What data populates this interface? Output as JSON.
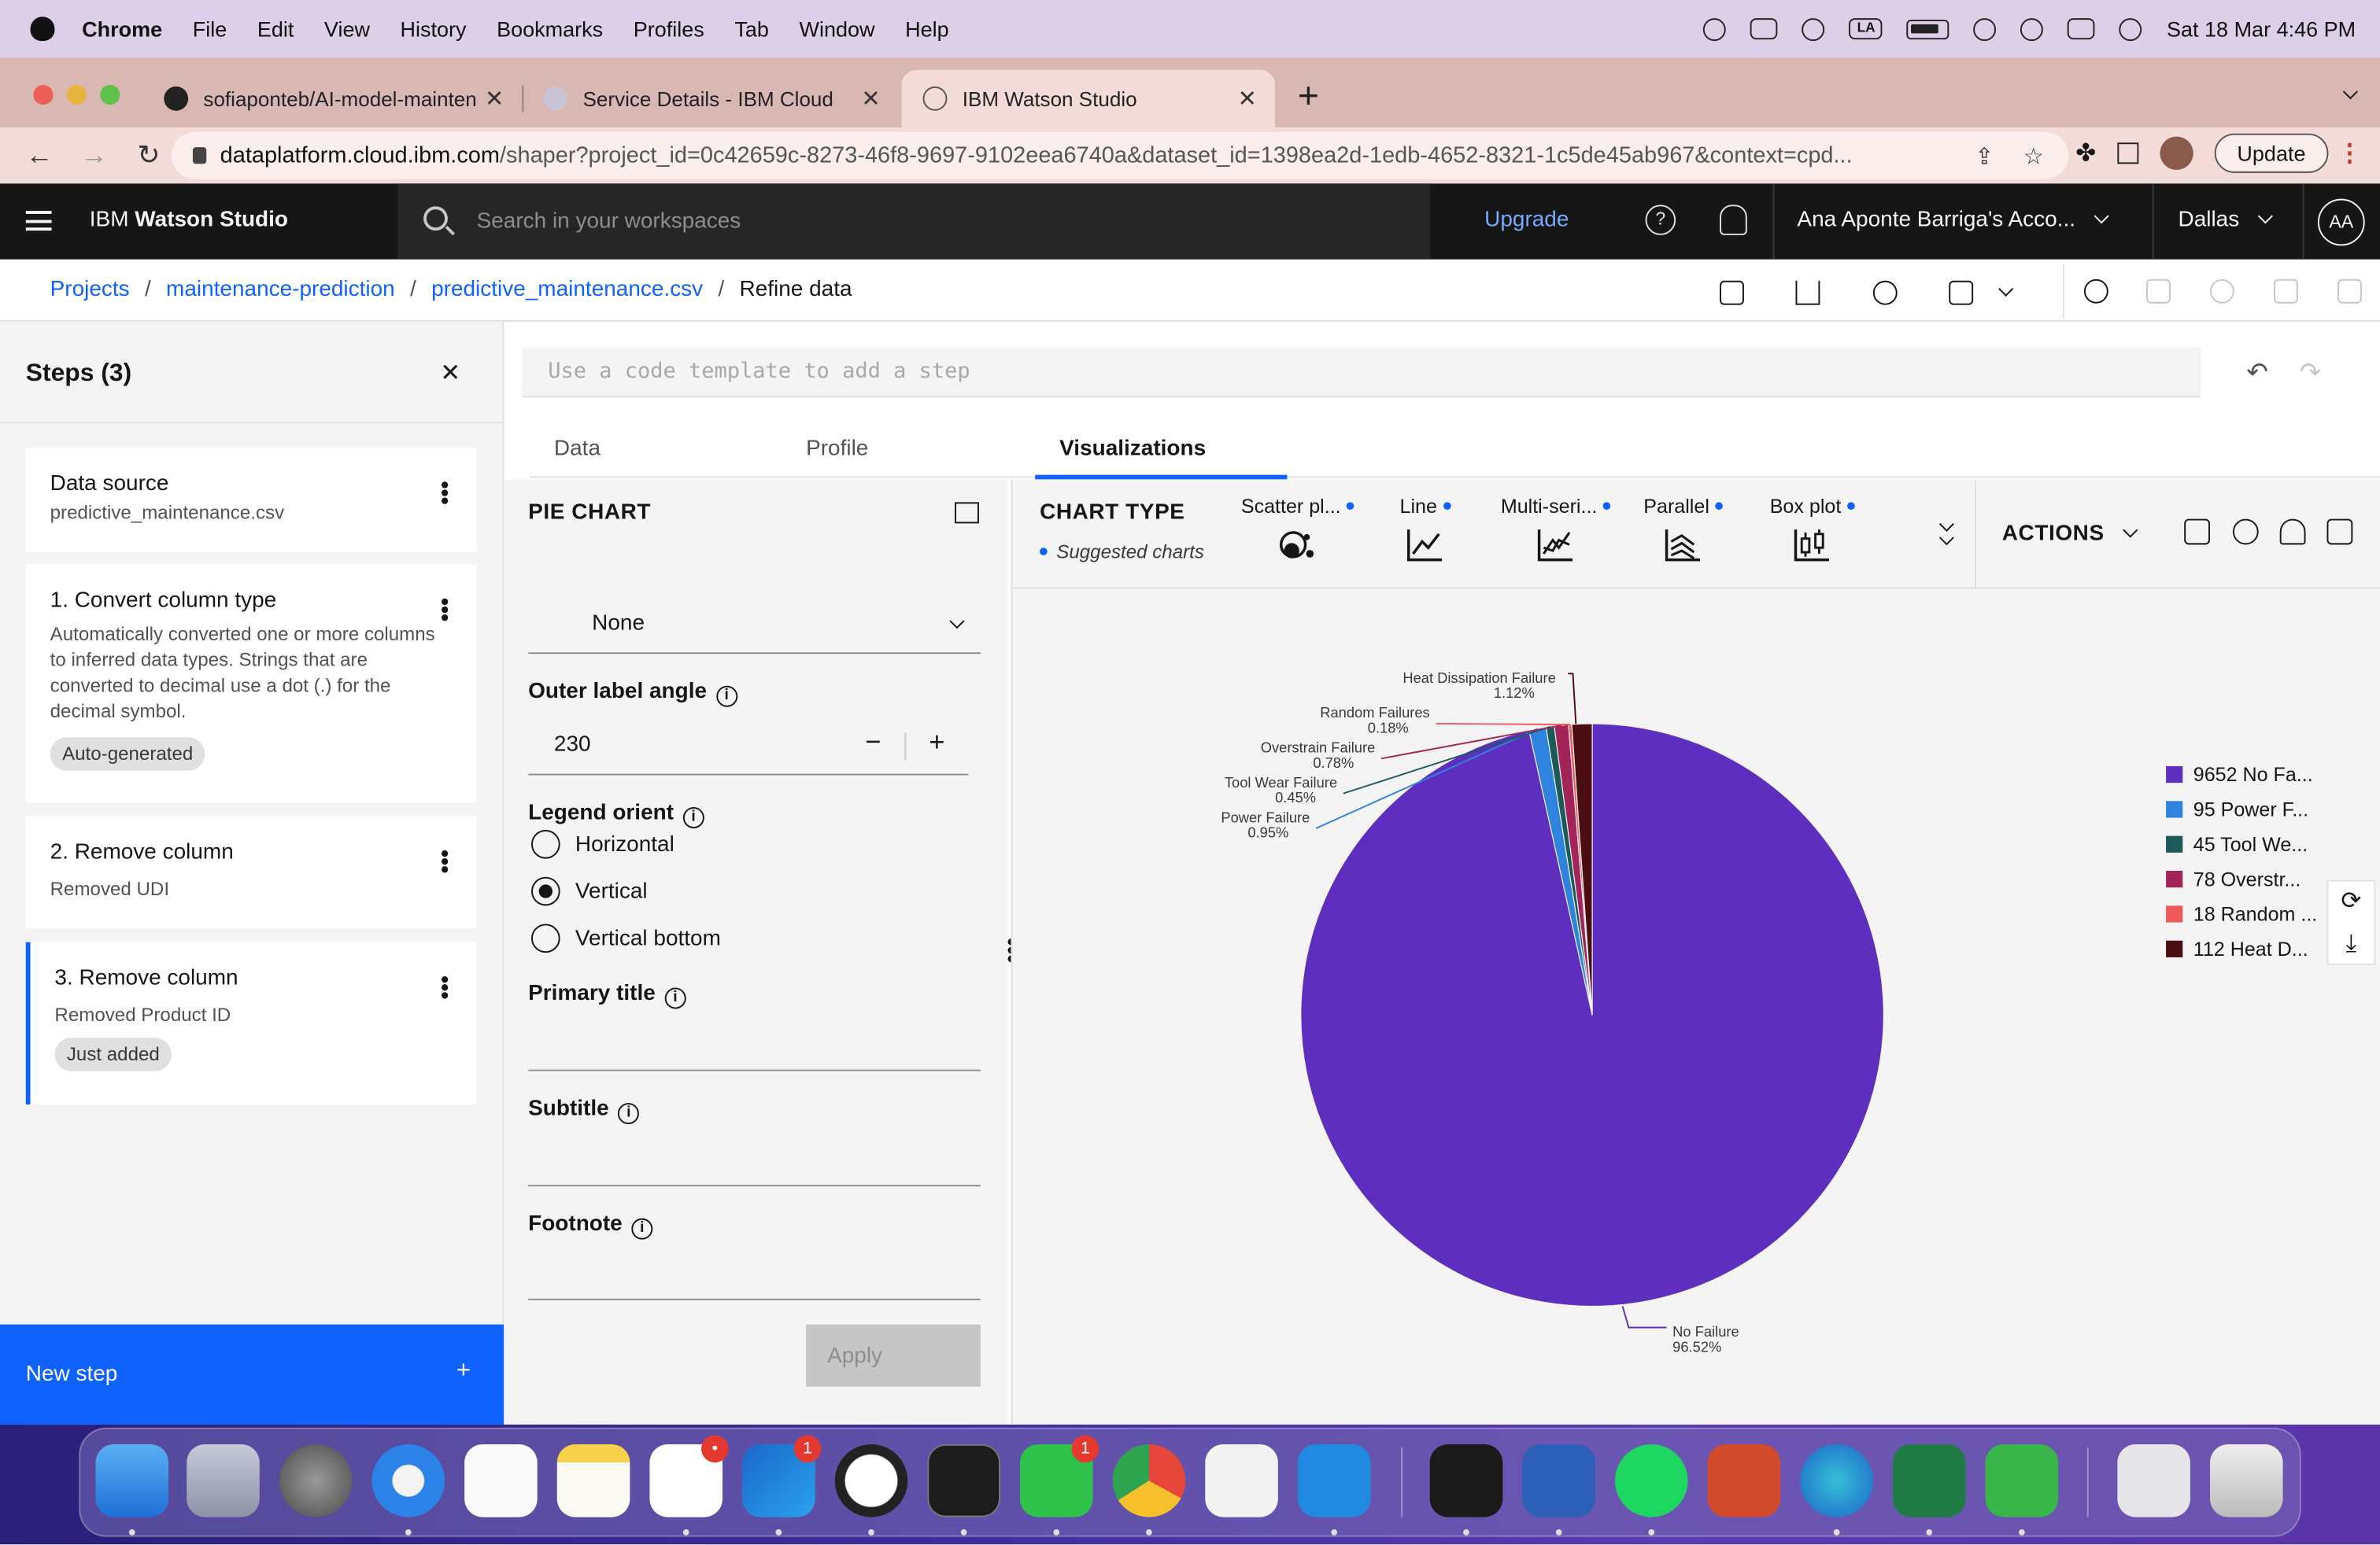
{
  "menubar": {
    "app": "Chrome",
    "items": [
      "File",
      "Edit",
      "View",
      "History",
      "Bookmarks",
      "Profiles",
      "Tab",
      "Window",
      "Help"
    ],
    "status_la": "LA",
    "datetime": "Sat 18 Mar  4:46 PM"
  },
  "browser": {
    "tabs": [
      {
        "title": "sofiaponteb/AI-model-mainten"
      },
      {
        "title": "Service Details - IBM Cloud"
      },
      {
        "title": "IBM Watson Studio"
      }
    ],
    "url_host": "dataplatform.cloud.ibm.com",
    "url_path": "/shaper?project_id=0c42659c-8273-46f8-9697-9102eea6740a&dataset_id=1398ea2d-1edb-4652-8321-1c5de45ab967&context=cpd...",
    "update_label": "Update"
  },
  "header": {
    "brand_prefix": "IBM",
    "brand_name": "Watson Studio",
    "search_placeholder": "Search in your workspaces",
    "upgrade": "Upgrade",
    "account": "Ana Aponte Barriga's Acco...",
    "region": "Dallas",
    "avatar": "AA"
  },
  "breadcrumb": {
    "items": [
      "Projects",
      "maintenance-prediction",
      "predictive_maintenance.csv"
    ],
    "current": "Refine data"
  },
  "steps": {
    "title": "Steps (3)",
    "cards": [
      {
        "title": "Data source",
        "desc": "predictive_maintenance.csv"
      },
      {
        "title": "1. Convert column type",
        "desc": "Automatically converted one or more columns to inferred data types. Strings that are converted to decimal use a dot (.) for the decimal symbol.",
        "tag": "Auto-generated"
      },
      {
        "title": "2. Remove column",
        "desc": "Removed UDI"
      },
      {
        "title": "3. Remove column",
        "desc": "Removed Product ID",
        "tag": "Just added"
      }
    ],
    "new_step": "New step"
  },
  "code_placeholder": "Use a code template to add a step",
  "view_tabs": [
    "Data",
    "Profile",
    "Visualizations"
  ],
  "pie_panel": {
    "title": "PIE CHART",
    "select_value": "None",
    "outer_label_angle_label": "Outer label angle",
    "outer_label_angle_value": "230",
    "legend_orient_label": "Legend orient",
    "legend_options": [
      "Horizontal",
      "Vertical",
      "Vertical bottom"
    ],
    "legend_selected": "Vertical",
    "primary_title_label": "Primary title",
    "subtitle_label": "Subtitle",
    "footnote_label": "Footnote",
    "apply": "Apply"
  },
  "chart_type_bar": {
    "title": "CHART TYPE",
    "suggested": "Suggested charts",
    "types": [
      "Scatter pl...",
      "Line",
      "Multi-seri...",
      "Parallel",
      "Box plot"
    ],
    "actions": "ACTIONS"
  },
  "chart_data": {
    "type": "pie",
    "slices": [
      {
        "label": "No Failure",
        "pct_label": "96.52%",
        "value": 9652,
        "legend": "9652 No Fa...",
        "color": "#5e2ebf"
      },
      {
        "label": "Power Failure",
        "pct_label": "0.95%",
        "value": 95,
        "legend": "95 Power F...",
        "color": "#2e83df"
      },
      {
        "label": "Tool Wear Failure",
        "pct_label": "0.45%",
        "value": 45,
        "legend": "45 Tool We...",
        "color": "#1c5a5a"
      },
      {
        "label": "Overstrain Failure",
        "pct_label": "0.78%",
        "value": 78,
        "legend": "78 Overstr...",
        "color": "#a32459"
      },
      {
        "label": "Random Failures",
        "pct_label": "0.18%",
        "value": 18,
        "legend": "18 Random ...",
        "color": "#ee5a5a"
      },
      {
        "label": "Heat Dissipation Failure",
        "pct_label": "1.12%",
        "value": 112,
        "legend": "112 Heat D...",
        "color": "#4a0d12"
      }
    ],
    "legend_placement": "right"
  }
}
